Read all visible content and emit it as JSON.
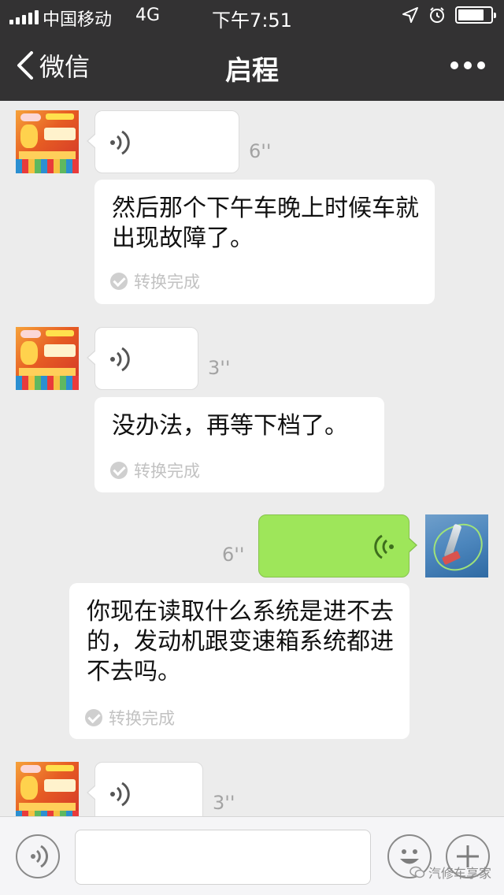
{
  "status_bar": {
    "carrier": "中国移动",
    "network": "4G",
    "time": "下午7:51"
  },
  "nav": {
    "back_label": "微信",
    "title": "启程"
  },
  "messages": [
    {
      "duration": "6''",
      "transcript": "然后那个下午车晚上时候车就出现故障了。",
      "status": "转换完成"
    },
    {
      "duration": "3''",
      "transcript": "没办法，再等下档了。",
      "status": "转换完成"
    },
    {
      "duration": "6''",
      "transcript": "你现在读取什么系统是进不去的，发动机跟变速箱系统都进不去吗。",
      "status": "转换完成"
    },
    {
      "duration": "3''"
    }
  ],
  "input_bar": {
    "input_value": "",
    "watermark": "汽修车享家"
  },
  "colors": {
    "nav_bg": "#333233",
    "chat_bg": "#ececec",
    "outgoing_bubble": "#9ee65a",
    "transcript_status": "#c2c2c2"
  },
  "icons": [
    "back-chevron-icon",
    "more-icon",
    "location-arrow-icon",
    "alarm-icon",
    "battery-icon",
    "voice-wave-icon",
    "check-icon",
    "voice-mode-icon",
    "emoji-icon",
    "plus-icon",
    "wechat-logo-icon"
  ]
}
